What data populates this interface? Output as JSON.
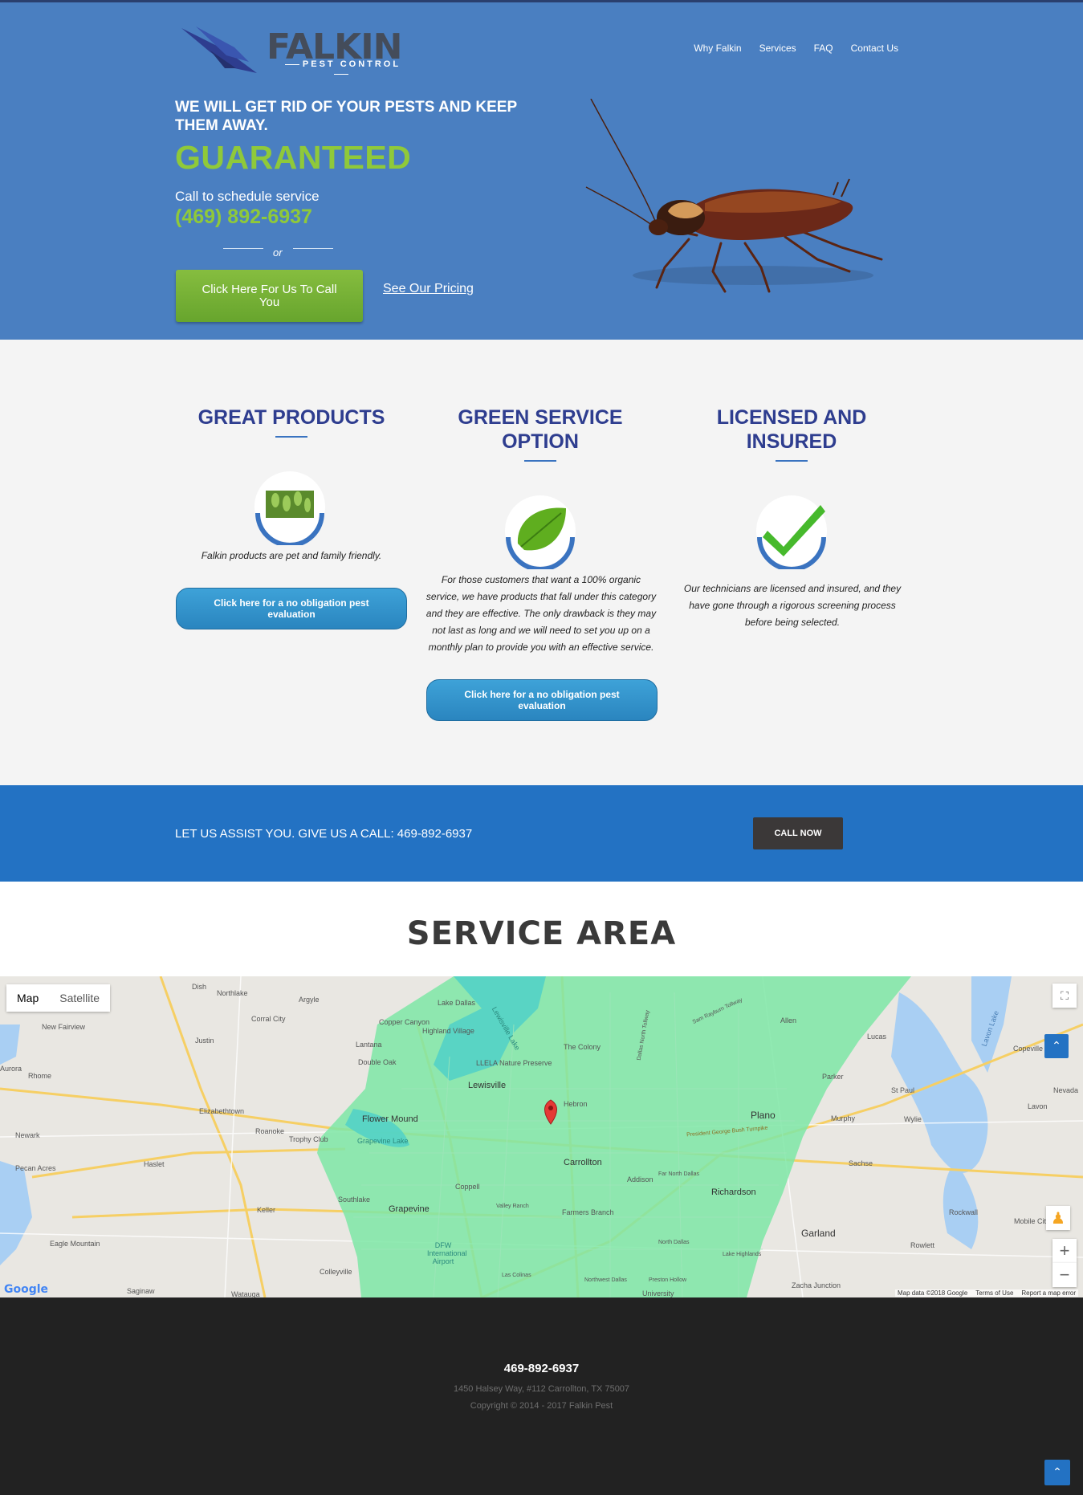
{
  "header": {
    "logo": {
      "word": "FALKIN",
      "sub": "PEST CONTROL"
    },
    "nav": [
      "Why Falkin",
      "Services",
      "FAQ",
      "Contact Us"
    ]
  },
  "hero": {
    "headline": "We will get rid of your pests and keep them away.",
    "guarantee": "GUARANTEED",
    "call_label": "Call to schedule service",
    "phone": "(469) 892-6937",
    "or": "or",
    "callback_button": "Click Here For Us To Call You",
    "pricing_link": "See Our Pricing"
  },
  "features": [
    {
      "title": "Great Products",
      "icon": "leaves-icon",
      "text": "Falkin products are pet and family friendly.",
      "button": "Click here for a no obligation pest evaluation"
    },
    {
      "title": "Green Service Option",
      "icon": "leaf-icon",
      "text": "For those customers that want a 100% organic service, we have products that fall under this category and they are effective. The only drawback is they may not last as long and we will need to set you up on a monthly plan to provide you with an effective service.",
      "button": "Click here for a no obligation pest evaluation"
    },
    {
      "title": "Licensed and Insured",
      "icon": "checkmark-icon",
      "text": "Our technicians are licensed and insured, and they have gone through a rigorous screening process before being selected."
    }
  ],
  "cta": {
    "text": "LET US ASSIST YOU. GIVE US A CALL: 469-892-6937",
    "button": "CALL NOW"
  },
  "service_area": {
    "title": "SERVICE AREA",
    "map_types": [
      "Map",
      "Satellite"
    ],
    "places": [
      "Dish",
      "Northlake",
      "Argyle",
      "Corral City",
      "New Fairview",
      "Justin",
      "Rhome",
      "Aurora",
      "Elizabethtown",
      "Roanoke",
      "Trophy Club",
      "Newark",
      "Haslet",
      "Pecan Acres",
      "Keller",
      "Southlake",
      "Eagle Mountain",
      "Saginaw",
      "Watauga",
      "Colleyville",
      "Lake Dallas",
      "Copper Canyon",
      "Highland Village",
      "Lantana",
      "Double Oak",
      "LLELA Nature Preserve",
      "Lewisville",
      "The Colony",
      "Hebron",
      "Flower Mound",
      "Grapevine Lake",
      "Coppell",
      "Grapevine",
      "Carrollton",
      "Addison",
      "Farmers Branch",
      "Valley Ranch",
      "DFW International Airport",
      "Las Colinas",
      "Northwest Dallas",
      "Preston Hollow",
      "University",
      "Far North Dallas",
      "North Dallas",
      "Richardson",
      "Lake Highlands",
      "Plano",
      "Allen",
      "Parker",
      "Murphy",
      "Wylie",
      "Sachse",
      "Lucas",
      "St Paul",
      "Nevada",
      "Lavon",
      "Copeville",
      "Lavon Lake",
      "Rockwall",
      "Mobile City",
      "Rowlett",
      "Garland",
      "Zacha Junction",
      "Lewisville Lake",
      "Sam Rayburn Tollway",
      "Dallas North Tollway",
      "President George Bush Turnpike"
    ],
    "map_footer": [
      "Map data ©2018 Google",
      "Terms of Use",
      "Report a map error"
    ],
    "google": "Google"
  },
  "footer": {
    "phone": "469-892-6937",
    "address": "1450 Halsey Way, #112 Carrollton, TX 75007",
    "copyright": "Copyright © 2014 - 2017 Falkin Pest"
  },
  "colors": {
    "hero_bg": "#4a7fc1",
    "accent_green": "#8fc93a",
    "feature_title": "#2e3d8f",
    "cta_bg": "#2372c3",
    "footer_bg": "#222222"
  }
}
